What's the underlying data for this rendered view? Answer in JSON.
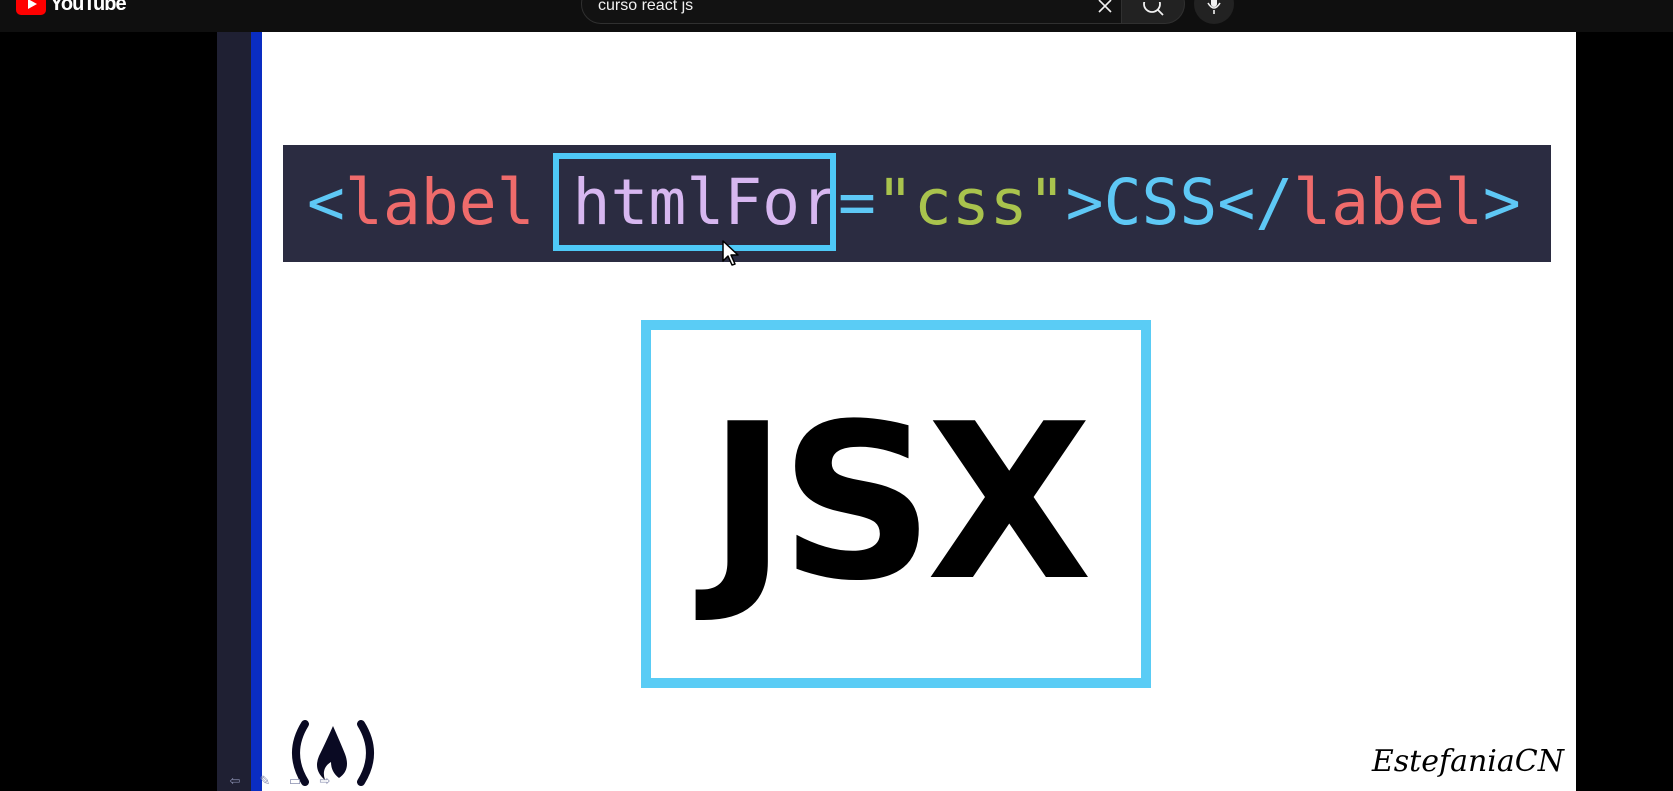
{
  "app": {
    "logo_text": "YouTube"
  },
  "search": {
    "value": "curso react js",
    "placeholder": "Search"
  },
  "video": {
    "code_tokens": {
      "open_bracket": "<",
      "tag": "label",
      "space": " ",
      "attr": "htmlFor",
      "eq": "=",
      "string": "\"css\"",
      "close_bracket": ">",
      "text": "CSS",
      "end_open": "</",
      "end_tag": "label",
      "end_close": ">"
    },
    "jsx_label": "JSX",
    "watermark": "EstefaniaCN",
    "fcc_logo": "(🔥)"
  },
  "colors": {
    "accent": "#5accf5",
    "tag": "#ef6b6b",
    "attr": "#d7b7f0",
    "string": "#a9c34d",
    "code_bg": "#2b2c41"
  }
}
